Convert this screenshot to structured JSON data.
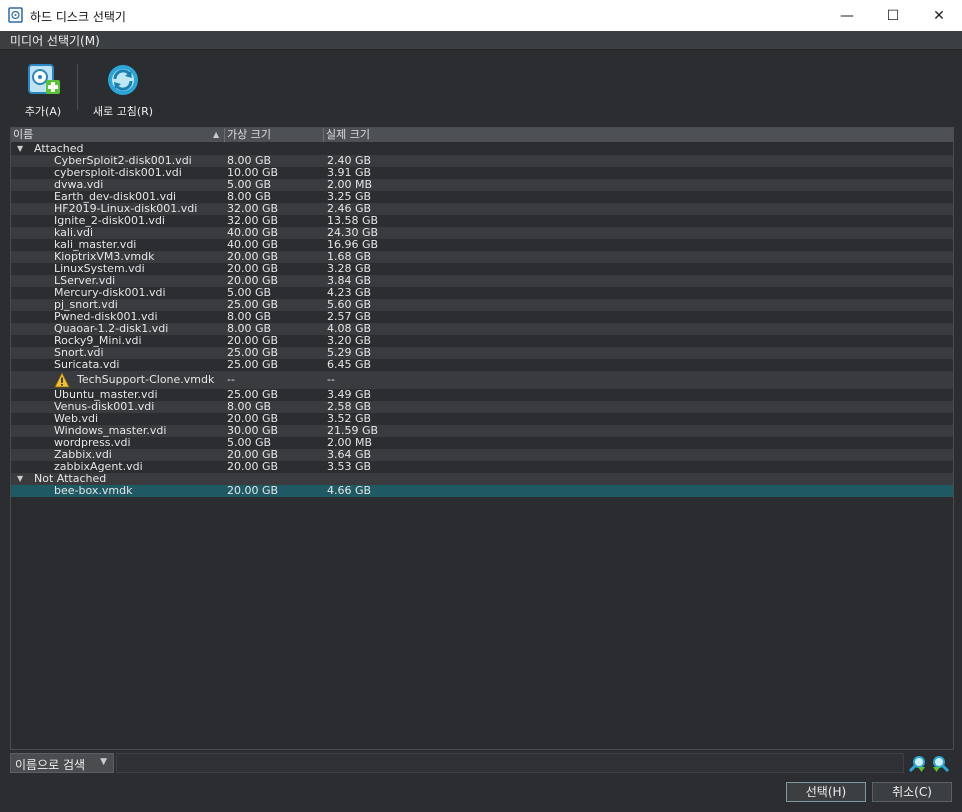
{
  "window": {
    "title": "하드 디스크 선택기",
    "minimize": "—",
    "maximize": "☐",
    "close": "✕"
  },
  "menu": {
    "items": [
      {
        "label": "미디어 선택기(M)"
      }
    ]
  },
  "toolbar": {
    "add_label": "추가(A)",
    "refresh_label": "새로 고침(R)"
  },
  "table": {
    "columns": [
      "이름",
      "가상 크기",
      "실제 크기"
    ],
    "groups": [
      {
        "name": "Attached",
        "rows": [
          {
            "name": "CyberSploit2-disk001.vdi",
            "virtual": "8.00 GB",
            "actual": "2.40 GB"
          },
          {
            "name": "cybersploit-disk001.vdi",
            "virtual": "10.00 GB",
            "actual": "3.91 GB"
          },
          {
            "name": "dvwa.vdi",
            "virtual": "5.00 GB",
            "actual": "2.00 MB"
          },
          {
            "name": "Earth_dev-disk001.vdi",
            "virtual": "8.00 GB",
            "actual": "3.25 GB"
          },
          {
            "name": "HF2019-Linux-disk001.vdi",
            "virtual": "32.00 GB",
            "actual": "2.46 GB"
          },
          {
            "name": "Ignite_2-disk001.vdi",
            "virtual": "32.00 GB",
            "actual": "13.58 GB"
          },
          {
            "name": "kali.vdi",
            "virtual": "40.00 GB",
            "actual": "24.30 GB"
          },
          {
            "name": "kali_master.vdi",
            "virtual": "40.00 GB",
            "actual": "16.96 GB"
          },
          {
            "name": "KioptrixVM3.vmdk",
            "virtual": "20.00 GB",
            "actual": "1.68 GB"
          },
          {
            "name": "LinuxSystem.vdi",
            "virtual": "20.00 GB",
            "actual": "3.28 GB"
          },
          {
            "name": "LServer.vdi",
            "virtual": "20.00 GB",
            "actual": "3.84 GB"
          },
          {
            "name": "Mercury-disk001.vdi",
            "virtual": "5.00 GB",
            "actual": "4.23 GB"
          },
          {
            "name": "pj_snort.vdi",
            "virtual": "25.00 GB",
            "actual": "5.60 GB"
          },
          {
            "name": "Pwned-disk001.vdi",
            "virtual": "8.00 GB",
            "actual": "2.57 GB"
          },
          {
            "name": "Quaoar-1.2-disk1.vdi",
            "virtual": "8.00 GB",
            "actual": "4.08 GB"
          },
          {
            "name": "Rocky9_Mini.vdi",
            "virtual": "20.00 GB",
            "actual": "3.20 GB"
          },
          {
            "name": "Snort.vdi",
            "virtual": "25.00 GB",
            "actual": "5.29 GB"
          },
          {
            "name": "Suricata.vdi",
            "virtual": "25.00 GB",
            "actual": "6.45 GB"
          },
          {
            "name": "TechSupport-Clone.vmdk",
            "virtual": "--",
            "actual": "--",
            "warning": true
          },
          {
            "name": "Ubuntu_master.vdi",
            "virtual": "25.00 GB",
            "actual": "3.49 GB"
          },
          {
            "name": "Venus-disk001.vdi",
            "virtual": "8.00 GB",
            "actual": "2.58 GB"
          },
          {
            "name": "Web.vdi",
            "virtual": "20.00 GB",
            "actual": "3.52 GB"
          },
          {
            "name": "Windows_master.vdi",
            "virtual": "30.00 GB",
            "actual": "21.59 GB"
          },
          {
            "name": "wordpress.vdi",
            "virtual": "5.00 GB",
            "actual": "2.00 MB"
          },
          {
            "name": "Zabbix.vdi",
            "virtual": "20.00 GB",
            "actual": "3.64 GB"
          },
          {
            "name": "zabbixAgent.vdi",
            "virtual": "20.00 GB",
            "actual": "3.53 GB"
          }
        ]
      },
      {
        "name": "Not Attached",
        "rows": [
          {
            "name": "bee-box.vmdk",
            "virtual": "20.00 GB",
            "actual": "4.66 GB",
            "selected": true
          }
        ]
      }
    ]
  },
  "search": {
    "mode": "이름으로 검색",
    "value": ""
  },
  "buttons": {
    "select": "선택(H)",
    "cancel": "취소(C)"
  },
  "colors": {
    "selected_row": "#1f5a64",
    "accent_cyan": "#2aa7d8",
    "accent_green": "#5bc236",
    "warning_yellow": "#f2c12e"
  }
}
